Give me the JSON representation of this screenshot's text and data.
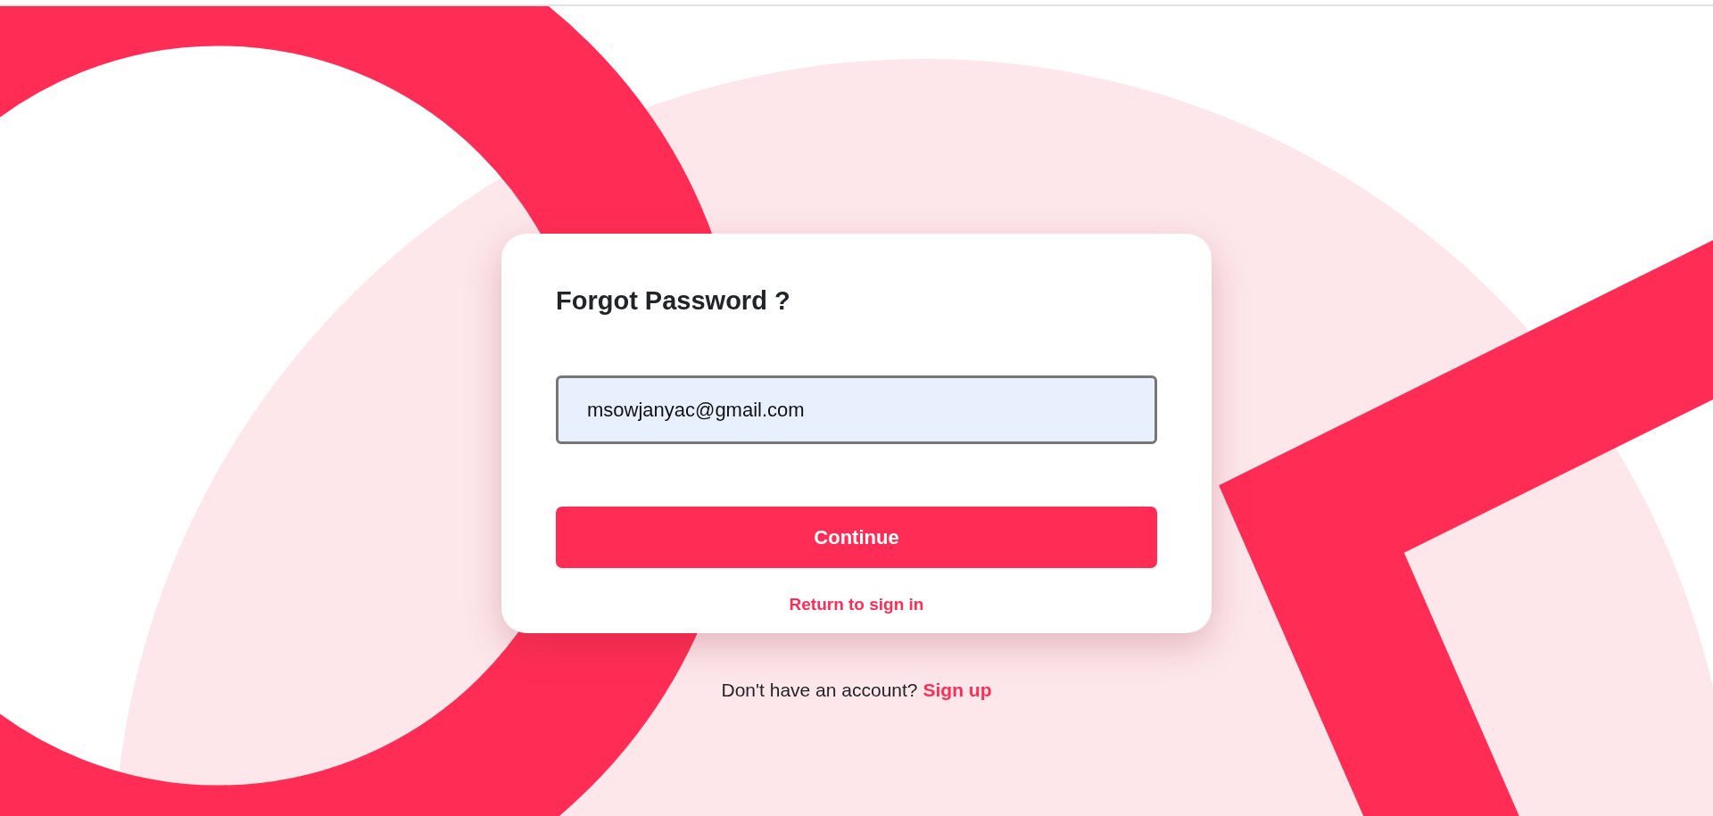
{
  "card": {
    "title": "Forgot Password ?",
    "email_field": {
      "value": "msowjanyac@gmail.com"
    },
    "continue_button": "Continue",
    "return_link": "Return to sign in"
  },
  "signup_prompt": {
    "text": "Don't have an account?",
    "link": "Sign up"
  }
}
